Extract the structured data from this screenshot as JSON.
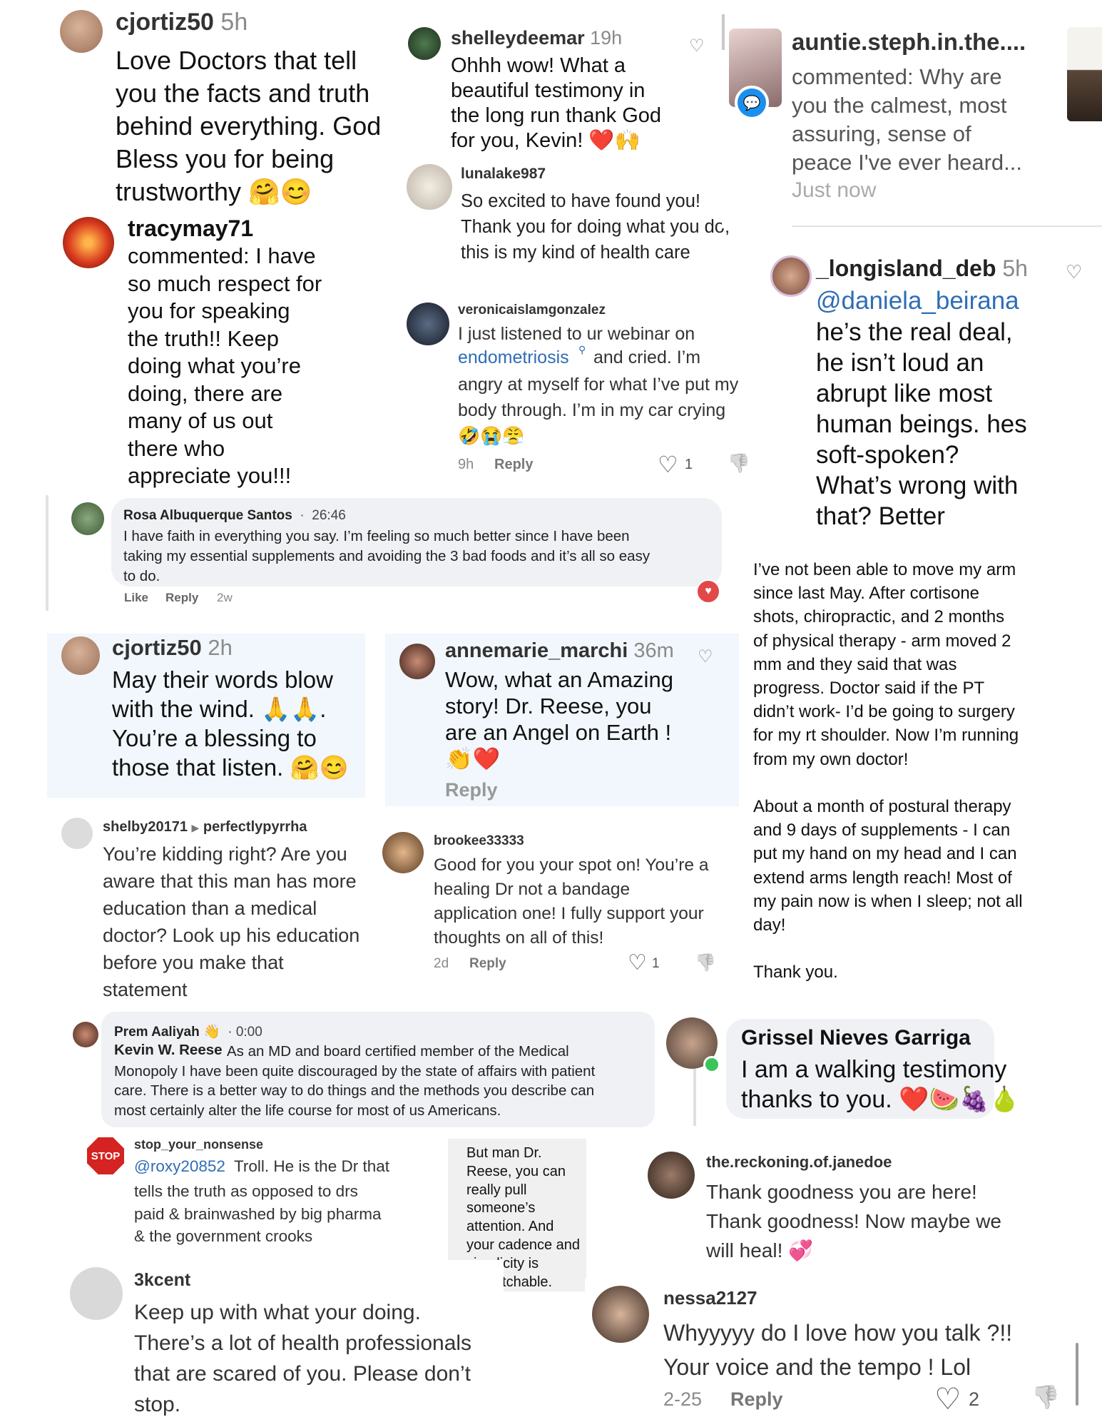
{
  "comments": {
    "c1": {
      "user": "cjortiz50",
      "time": "5h",
      "text": "Love Doctors that tell\nyou the facts and truth\nbehind everything. God\nBless you for being\ntrustworthy 🤗😊"
    },
    "c2": {
      "user": "shelleydeemar",
      "time": "19h",
      "text": "Ohhh wow! What a\nbeautiful testimony in\nthe long run thank God\nfor you, Kevin! ❤️🙌"
    },
    "c3": {
      "user": "auntie.steph.in.the....",
      "text": "commented: Why are\nyou the calmest, most\nassuring, sense of\npeace I've ever heard...",
      "time": "Just now"
    },
    "c4": {
      "user": "lunalake987",
      "text": "So excited to have found you!\nThank you for doing what you do,\nthis is my kind of health care"
    },
    "c5": {
      "user": "tracymay71",
      "text": "commented: I have\nso much respect for\nyou for speaking\nthe truth!! Keep\ndoing what you’re\ndoing, there are\nmany  of us out\nthere who\nappreciate you!!!"
    },
    "c6": {
      "user": "veronicaislamgonzalez",
      "text_before": "I just listened to ur webinar on",
      "link": "endometriosis",
      "text_after": "and cried. I’m",
      "text_rest": "angry at myself for what I’ve put my\nbody through. I’m in my car crying\n🤣😭😤",
      "time": "9h",
      "reply": "Reply",
      "likes": "1"
    },
    "c7": {
      "user": "_longisland_deb",
      "time": "5h",
      "mention": "@daniela_beirana",
      "text": "he’s the real deal,\nhe isn’t loud an\nabrupt like most\nhuman beings. hes\nsoft-spoken?\nWhat’s wrong with\nthat?  Better"
    },
    "c8": {
      "user": "Rosa Albuquerque Santos",
      "time": "26:46",
      "text": "I have faith in everything you say. I’m feeling so much better since I have been\ntaking my essential supplements and avoiding the 3 bad foods and it’s all so easy\nto do.",
      "like": "Like",
      "reply": "Reply",
      "age": "2w"
    },
    "c9": {
      "text": "I’ve not been able to move my arm\nsince last May. After cortisone\nshots, chiropractic, and 2 months\nof physical therapy - arm moved 2\nmm and they said that was\nprogress. Doctor said if the PT\ndidn’t work- I’d be going to surgery\nfor my rt shoulder. Now I’m running\nfrom my own doctor!\n\nAbout a month of postural therapy\nand 9 days of supplements - I can\nput my hand on my head and I can\nextend arms length reach! Most of\nmy pain now is when I sleep; not all\nday!\n\nThank you."
    },
    "c10": {
      "user": "cjortiz50",
      "time": "2h",
      "text": "May their words blow\nwith the wind. 🙏🙏.\nYou’re a blessing to\nthose that listen. 🤗😊"
    },
    "c11": {
      "user": "annemarie_marchi",
      "time": "36m",
      "text": "Wow, what an Amazing\nstory! Dr. Reese, you\nare an Angel on Earth !\n👏❤️",
      "reply": "Reply"
    },
    "c12": {
      "user": "shelby20171",
      "reply_to": "perfectlypyrrha",
      "text": "You’re kidding right? Are you\naware that this man has more\neducation than a medical\ndoctor? Look up his education\nbefore you make that\nstatement"
    },
    "c13": {
      "user": "brookee33333",
      "text": "Good for you your spot on! You’re a\nhealing Dr not a bandage\napplication one! I fully support your\nthoughts on all of this!",
      "time": "2d",
      "reply": "Reply",
      "likes": "1"
    },
    "c14": {
      "user": "Prem Aaliyah",
      "time": "0:00",
      "name_bold": "Kevin W. Reese",
      "text": "As an MD and board certified member of the Medical\nMonopoly I have been quite discouraged by the state of affairs with patient\ncare. There is a better way to do things and the methods you describe can\nmost certainly alter the life course for most of us Americans."
    },
    "c15": {
      "user": "Grissel Nieves Garriga",
      "text": "I am a walking testimony\nthanks to you. ❤️🍉🍇🍐"
    },
    "c16": {
      "user": "stop_your_nonsense",
      "mention": "@roxy20852",
      "text_first": "Troll. He is the Dr that",
      "text": "tells the truth as opposed to drs\npaid & brainwashed by big pharma\n& the government crooks"
    },
    "c17": {
      "text": "But man Dr.\nReese, you can\nreally pull\nsomeone’s\nattention. And\nyour cadence and\nsimplicity is\nunmatchable."
    },
    "c18": {
      "user": "the.reckoning.of.janedoe",
      "text": "Thank goodness you are here!\nThank goodness! Now maybe we\nwill heal! 💞"
    },
    "c19": {
      "user": "3kcent",
      "text": "Keep up with what your doing.\nThere’s a lot of health professionals\nthat are scared of you. Please don’t\nstop."
    },
    "c20": {
      "user": "nessa2127",
      "text": "Whyyyyy do I love how you talk ?!!\nYour voice and the tempo ! Lol",
      "time": "2-25",
      "reply": "Reply",
      "likes": "2"
    }
  },
  "icons": {
    "heart": "♡",
    "dislike": "👎",
    "stop_badge": "STOP",
    "messenger": "💬",
    "wave": "👋"
  },
  "colors": {
    "link": "#2f6db5",
    "bubble": "#f0f1f4",
    "card_blue": "#f1f7fc",
    "red": "#e24848"
  }
}
